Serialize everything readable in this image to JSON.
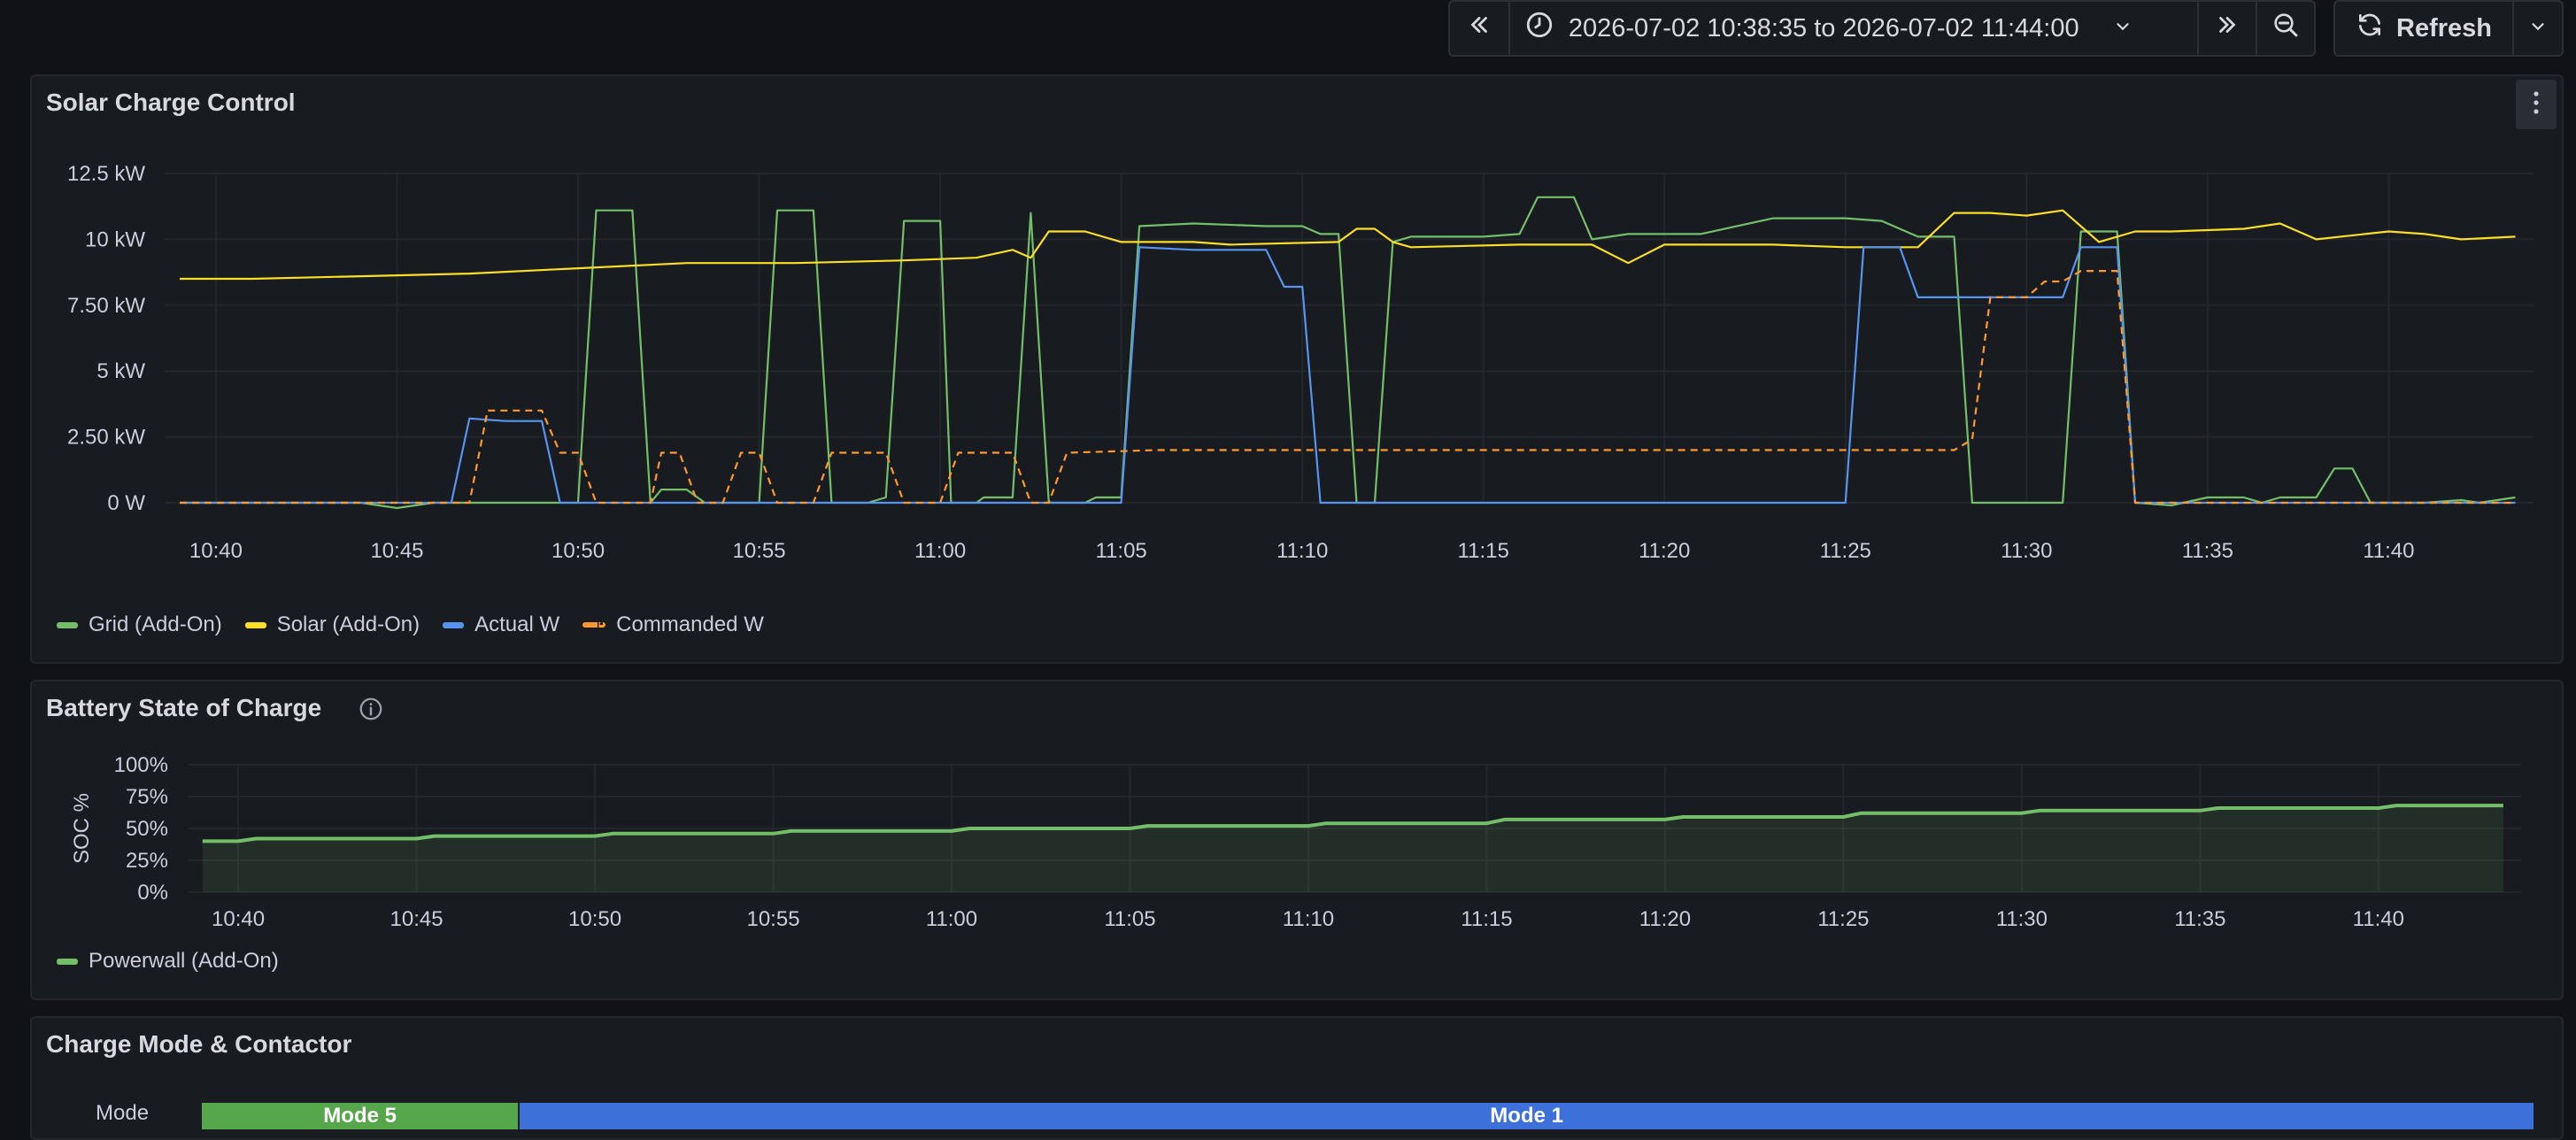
{
  "toolbar": {
    "time_range": "2026-07-02 10:38:35 to 2026-07-02 11:44:00",
    "refresh_label": "Refresh",
    "icons": [
      "shift-back-icon",
      "clock-icon",
      "chevron-down-icon",
      "shift-forward-icon",
      "zoom-out-icon",
      "refresh-icon",
      "chevron-down-icon"
    ]
  },
  "colors": {
    "grid": "#73bf69",
    "solar": "#fade2a",
    "actual": "#5794f2",
    "commanded": "#ff9830",
    "mode5": "#56a64b",
    "mode1": "#3d71d9",
    "accent_red": "#c4162a"
  },
  "panels": {
    "solar": {
      "title": "Solar Charge Control"
    },
    "battery": {
      "title": "Battery State of Charge"
    },
    "mode": {
      "title": "Charge Mode & Contactor",
      "row_label": "Mode"
    }
  },
  "chart_data": [
    {
      "type": "line",
      "title": "Solar Charge Control",
      "x_unit": "time",
      "xlim": [
        "10:38:35",
        "11:44:00"
      ],
      "x_ticks": [
        "10:40",
        "10:45",
        "10:50",
        "10:55",
        "11:00",
        "11:05",
        "11:10",
        "11:15",
        "11:20",
        "11:25",
        "11:30",
        "11:35",
        "11:40"
      ],
      "ylim": [
        0,
        12.5
      ],
      "y_unit": "kW",
      "y_ticks": [
        "0 W",
        "2.50 kW",
        "5 kW",
        "7.50 kW",
        "10 kW",
        "12.5 kW"
      ],
      "legend_position": "bottom-left",
      "grid": true,
      "series": [
        {
          "name": "Grid (Add-On)",
          "color": "#73bf69",
          "dashed": false,
          "points": [
            [
              "10:39",
              0
            ],
            [
              "10:44",
              0
            ],
            [
              "10:45",
              -0.2
            ],
            [
              "10:46",
              0
            ],
            [
              "10:50",
              0
            ],
            [
              "10:50.5",
              11.1
            ],
            [
              "10:51.5",
              11.1
            ],
            [
              "10:52",
              0
            ],
            [
              "10:52.3",
              0.5
            ],
            [
              "10:53",
              0.5
            ],
            [
              "10:53.5",
              0
            ],
            [
              "10:55",
              0
            ],
            [
              "10:55.5",
              11.1
            ],
            [
              "10:56.5",
              11.1
            ],
            [
              "10:57",
              0
            ],
            [
              "10:58",
              0
            ],
            [
              "10:58.5",
              0.2
            ],
            [
              "10:59",
              10.7
            ],
            [
              "10:60",
              10.7
            ],
            [
              "11:00.3",
              0
            ],
            [
              "11:01",
              0
            ],
            [
              "11:01.2",
              0.2
            ],
            [
              "11:02",
              0.2
            ],
            [
              "11:02.5",
              11.0
            ],
            [
              "11:03",
              0
            ],
            [
              "11:04",
              0
            ],
            [
              "11:04.3",
              0.2
            ],
            [
              "11:05",
              0.2
            ],
            [
              "11:05.5",
              10.5
            ],
            [
              "11:07",
              10.6
            ],
            [
              "11:09",
              10.5
            ],
            [
              "11:10",
              10.5
            ],
            [
              "11:10.5",
              10.2
            ],
            [
              "11:11",
              10.2
            ],
            [
              "11:11.5",
              0
            ],
            [
              "11:12",
              0
            ],
            [
              "11:12.5",
              9.9
            ],
            [
              "11:13",
              10.1
            ],
            [
              "11:15",
              10.1
            ],
            [
              "11:16",
              10.2
            ],
            [
              "11:16.5",
              11.6
            ],
            [
              "11:17.5",
              11.6
            ],
            [
              "11:18",
              10.0
            ],
            [
              "11:19",
              10.2
            ],
            [
              "11:21",
              10.2
            ],
            [
              "11:23",
              10.8
            ],
            [
              "11:25",
              10.8
            ],
            [
              "11:26",
              10.7
            ],
            [
              "11:27",
              10.1
            ],
            [
              "11:28",
              10.1
            ],
            [
              "11:28.5",
              0
            ],
            [
              "11:31",
              0
            ],
            [
              "11:31.5",
              10.3
            ],
            [
              "11:32.5",
              10.3
            ],
            [
              "11:33",
              0
            ],
            [
              "11:34",
              -0.1
            ],
            [
              "11:35",
              0.2
            ],
            [
              "11:36",
              0.2
            ],
            [
              "11:36.5",
              0
            ],
            [
              "11:37",
              0.2
            ],
            [
              "11:38",
              0.2
            ],
            [
              "11:38.5",
              1.3
            ],
            [
              "11:39",
              1.3
            ],
            [
              "11:39.5",
              0
            ],
            [
              "11:41",
              0
            ],
            [
              "11:42",
              0.1
            ],
            [
              "11:42.5",
              0
            ],
            [
              "11:43.5",
              0.2
            ]
          ]
        },
        {
          "name": "Solar (Add-On)",
          "color": "#fade2a",
          "dashed": false,
          "points": [
            [
              "10:39",
              8.5
            ],
            [
              "10:41",
              8.5
            ],
            [
              "10:44",
              8.6
            ],
            [
              "10:47",
              8.7
            ],
            [
              "10:50",
              8.9
            ],
            [
              "10:53",
              9.1
            ],
            [
              "10:56",
              9.1
            ],
            [
              "10:59",
              9.2
            ],
            [
              "11:01",
              9.3
            ],
            [
              "11:02",
              9.6
            ],
            [
              "11:02.5",
              9.3
            ],
            [
              "11:03",
              10.3
            ],
            [
              "11:04",
              10.3
            ],
            [
              "11:05",
              9.9
            ],
            [
              "11:07",
              9.9
            ],
            [
              "11:08",
              9.8
            ],
            [
              "11:11",
              9.9
            ],
            [
              "11:11.5",
              10.4
            ],
            [
              "11:12",
              10.4
            ],
            [
              "11:12.5",
              9.9
            ],
            [
              "11:13",
              9.7
            ],
            [
              "11:16",
              9.8
            ],
            [
              "11:18",
              9.8
            ],
            [
              "11:19",
              9.1
            ],
            [
              "11:20",
              9.8
            ],
            [
              "11:23",
              9.8
            ],
            [
              "11:25",
              9.7
            ],
            [
              "11:27",
              9.7
            ],
            [
              "11:28",
              11.0
            ],
            [
              "11:29",
              11.0
            ],
            [
              "11:30",
              10.9
            ],
            [
              "11:31",
              11.1
            ],
            [
              "11:32",
              9.9
            ],
            [
              "11:33",
              10.3
            ],
            [
              "11:34",
              10.3
            ],
            [
              "11:36",
              10.4
            ],
            [
              "11:37",
              10.6
            ],
            [
              "11:38",
              10.0
            ],
            [
              "11:40",
              10.3
            ],
            [
              "11:41",
              10.2
            ],
            [
              "11:42",
              10.0
            ],
            [
              "11:43.5",
              10.1
            ]
          ]
        },
        {
          "name": "Actual W",
          "color": "#5794f2",
          "dashed": false,
          "points": [
            [
              "10:39",
              0
            ],
            [
              "10:46.5",
              0
            ],
            [
              "10:47",
              3.2
            ],
            [
              "10:48",
              3.1
            ],
            [
              "10:49",
              3.1
            ],
            [
              "10:49.5",
              0
            ],
            [
              "10:53",
              0
            ],
            [
              "11:05",
              0
            ],
            [
              "11:05.5",
              9.7
            ],
            [
              "11:07",
              9.6
            ],
            [
              "11:09",
              9.6
            ],
            [
              "11:09.5",
              8.2
            ],
            [
              "11:10",
              8.2
            ],
            [
              "11:10.5",
              0
            ],
            [
              "11:25",
              0
            ],
            [
              "11:25.5",
              9.7
            ],
            [
              "11:26.5",
              9.7
            ],
            [
              "11:27",
              7.8
            ],
            [
              "11:29",
              7.8
            ],
            [
              "11:30",
              7.8
            ],
            [
              "11:31",
              7.8
            ],
            [
              "11:31.5",
              9.7
            ],
            [
              "11:32.5",
              9.7
            ],
            [
              "11:33",
              0
            ],
            [
              "11:43.5",
              0
            ]
          ]
        },
        {
          "name": "Commanded W",
          "color": "#ff9830",
          "dashed": true,
          "points": [
            [
              "10:39",
              0
            ],
            [
              "10:47",
              0
            ],
            [
              "10:47.5",
              3.5
            ],
            [
              "10:49",
              3.5
            ],
            [
              "10:49.5",
              1.9
            ],
            [
              "10:50",
              1.9
            ],
            [
              "10:50.5",
              0
            ],
            [
              "10:52",
              0
            ],
            [
              "10:52.3",
              1.9
            ],
            [
              "10:52.8",
              1.9
            ],
            [
              "10:53.3",
              0
            ],
            [
              "10:54",
              0
            ],
            [
              "10:54.5",
              1.9
            ],
            [
              "10:55",
              1.9
            ],
            [
              "10:55.5",
              0
            ],
            [
              "10:56.5",
              0
            ],
            [
              "10:57",
              1.9
            ],
            [
              "10:58.5",
              1.9
            ],
            [
              "10:59",
              0
            ],
            [
              "11:00",
              0
            ],
            [
              "11:00.5",
              1.9
            ],
            [
              "11:02",
              1.9
            ],
            [
              "11:02.5",
              0
            ],
            [
              "11:03",
              0
            ],
            [
              "11:03.5",
              1.9
            ],
            [
              "11:06",
              2.0
            ],
            [
              "11:10",
              2.0
            ],
            [
              "11:28",
              2.0
            ],
            [
              "11:28.5",
              2.4
            ],
            [
              "11:29",
              7.8
            ],
            [
              "11:30",
              7.8
            ],
            [
              "11:30.5",
              8.4
            ],
            [
              "11:31",
              8.4
            ],
            [
              "11:31.5",
              8.8
            ],
            [
              "11:32.5",
              8.8
            ],
            [
              "11:33",
              0
            ],
            [
              "11:43.5",
              0
            ]
          ]
        }
      ]
    },
    {
      "type": "area",
      "title": "Battery State of Charge",
      "ylabel": "SOC %",
      "xlim": [
        "10:38:35",
        "11:44:00"
      ],
      "x_ticks": [
        "10:40",
        "10:45",
        "10:50",
        "10:55",
        "11:00",
        "11:05",
        "11:10",
        "11:15",
        "11:20",
        "11:25",
        "11:30",
        "11:35",
        "11:40"
      ],
      "ylim": [
        0,
        100
      ],
      "y_ticks": [
        "0%",
        "25%",
        "50%",
        "75%",
        "100%"
      ],
      "legend_position": "bottom-left",
      "grid": true,
      "series": [
        {
          "name": "Powerwall (Add-On)",
          "color": "#73bf69",
          "points": [
            [
              "10:39",
              40
            ],
            [
              "10:40",
              40
            ],
            [
              "10:40.5",
              42
            ],
            [
              "10:45",
              42
            ],
            [
              "10:45.5",
              44
            ],
            [
              "10:50",
              44
            ],
            [
              "10:50.5",
              46
            ],
            [
              "10:55",
              46
            ],
            [
              "10:55.5",
              48
            ],
            [
              "11:00",
              48
            ],
            [
              "11:00.5",
              50
            ],
            [
              "11:05",
              50
            ],
            [
              "11:05.5",
              52
            ],
            [
              "11:10",
              52
            ],
            [
              "11:10.5",
              54
            ],
            [
              "11:15",
              54
            ],
            [
              "11:15.5",
              57
            ],
            [
              "11:20",
              57
            ],
            [
              "11:20.5",
              59
            ],
            [
              "11:25",
              59
            ],
            [
              "11:25.5",
              62
            ],
            [
              "11:30",
              62
            ],
            [
              "11:30.5",
              64
            ],
            [
              "11:35",
              64
            ],
            [
              "11:35.5",
              66
            ],
            [
              "11:40",
              66
            ],
            [
              "11:40.5",
              68
            ],
            [
              "11:43.5",
              68
            ]
          ]
        }
      ]
    },
    {
      "type": "state-timeline",
      "title": "Charge Mode & Contactor",
      "rows": [
        {
          "label": "Mode",
          "segments": [
            {
              "value": "Mode 5",
              "start": "10:38:35",
              "end": "10:47:30"
            },
            {
              "value": "Mode 1",
              "start": "10:47:30",
              "end": "11:44:00"
            }
          ]
        }
      ]
    }
  ]
}
